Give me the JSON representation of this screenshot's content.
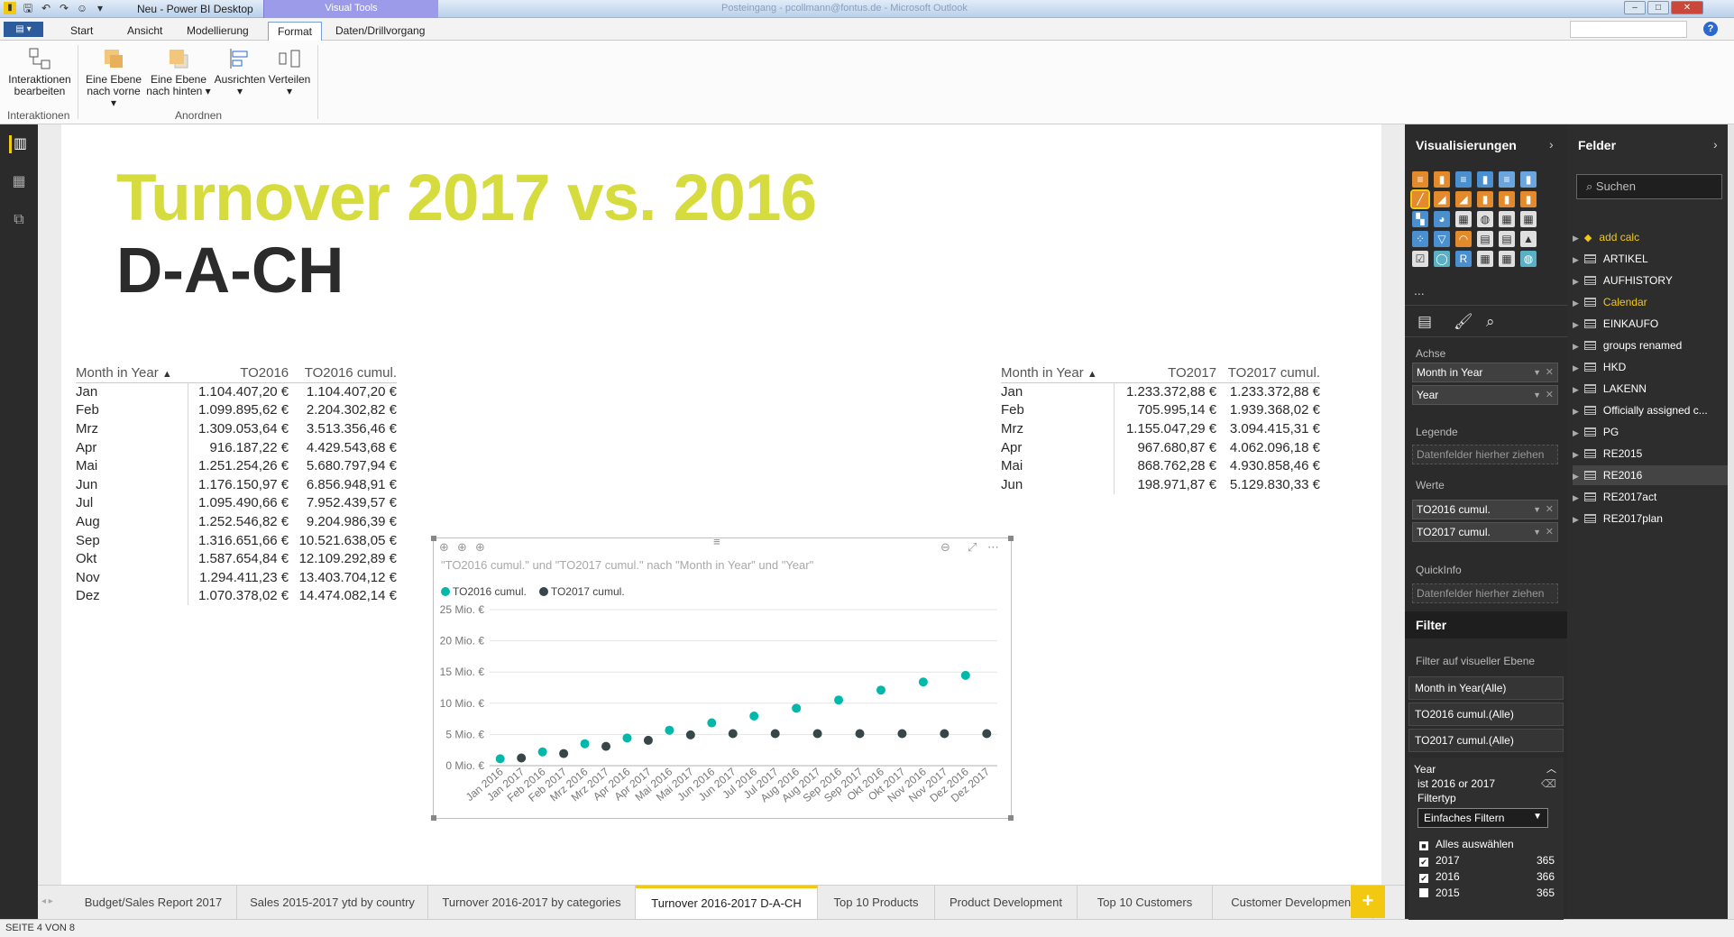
{
  "window": {
    "title": "Neu - Power BI Desktop",
    "visual_tools": "Visual Tools",
    "blurred_title": "Posteingang - pcollmann@fontus.de - Microsoft Outlook",
    "buttons": [
      "–",
      "□",
      "✕"
    ]
  },
  "ribbon_tabs": [
    "Start",
    "Ansicht",
    "Modellierung",
    "Format",
    "Daten/Drillvorgang"
  ],
  "ribbon": {
    "interactions": {
      "line1": "Interaktionen",
      "line2": "bearbeiten",
      "group": "Interaktionen"
    },
    "forward": {
      "line1": "Eine Ebene",
      "line2": "nach vorne ▾"
    },
    "backward": {
      "line1": "Eine Ebene",
      "line2": "nach hinten ▾"
    },
    "align": {
      "line1": "Ausrichten",
      "line2": "▾"
    },
    "distribute": {
      "line1": "Verteilen",
      "line2": "▾"
    },
    "arrange_group": "Anordnen"
  },
  "report": {
    "title_line1": "Turnover 2017 vs. 2016",
    "title_line2": "D-A-CH"
  },
  "table2016": {
    "headers": [
      "Month in Year",
      "TO2016",
      "TO2016 cumul."
    ],
    "rows": [
      [
        "Jan",
        "1.104.407,20 €",
        "1.104.407,20 €"
      ],
      [
        "Feb",
        "1.099.895,62 €",
        "2.204.302,82 €"
      ],
      [
        "Mrz",
        "1.309.053,64 €",
        "3.513.356,46 €"
      ],
      [
        "Apr",
        "916.187,22 €",
        "4.429.543,68 €"
      ],
      [
        "Mai",
        "1.251.254,26 €",
        "5.680.797,94 €"
      ],
      [
        "Jun",
        "1.176.150,97 €",
        "6.856.948,91 €"
      ],
      [
        "Jul",
        "1.095.490,66 €",
        "7.952.439,57 €"
      ],
      [
        "Aug",
        "1.252.546,82 €",
        "9.204.986,39 €"
      ],
      [
        "Sep",
        "1.316.651,66 €",
        "10.521.638,05 €"
      ],
      [
        "Okt",
        "1.587.654,84 €",
        "12.109.292,89 €"
      ],
      [
        "Nov",
        "1.294.411,23 €",
        "13.403.704,12 €"
      ],
      [
        "Dez",
        "1.070.378,02 €",
        "14.474.082,14 €"
      ]
    ]
  },
  "table2017": {
    "headers": [
      "Month in Year",
      "TO2017",
      "TO2017 cumul."
    ],
    "rows": [
      [
        "Jan",
        "1.233.372,88 €",
        "1.233.372,88 €"
      ],
      [
        "Feb",
        "705.995,14 €",
        "1.939.368,02 €"
      ],
      [
        "Mrz",
        "1.155.047,29 €",
        "3.094.415,31 €"
      ],
      [
        "Apr",
        "967.680,87 €",
        "4.062.096,18 €"
      ],
      [
        "Mai",
        "868.762,28 €",
        "4.930.858,46 €"
      ],
      [
        "Jun",
        "198.971,87 €",
        "5.129.830,33 €"
      ]
    ]
  },
  "chart_data": {
    "type": "scatter",
    "title": "\"TO2016 cumul.\" und \"TO2017 cumul.\" nach \"Month in Year\" und \"Year\"",
    "categories": [
      "Jan 2016",
      "Jan 2017",
      "Feb 2016",
      "Feb 2017",
      "Mrz 2016",
      "Mrz 2017",
      "Apr 2016",
      "Apr 2017",
      "Mai 2016",
      "Mai 2017",
      "Jun 2016",
      "Jun 2017",
      "Jul 2016",
      "Jul 2017",
      "Aug 2016",
      "Aug 2017",
      "Sep 2016",
      "Sep 2017",
      "Okt 2016",
      "Okt 2017",
      "Nov 2016",
      "Nov 2017",
      "Dez 2016",
      "Dez 2017"
    ],
    "series": [
      {
        "name": "TO2016 cumul.",
        "color": "#01b8aa",
        "values": [
          1.1,
          null,
          2.2,
          null,
          3.51,
          null,
          4.43,
          null,
          5.68,
          null,
          6.86,
          null,
          7.95,
          null,
          9.2,
          null,
          10.52,
          null,
          12.11,
          null,
          13.4,
          null,
          14.47,
          null
        ]
      },
      {
        "name": "TO2017 cumul.",
        "color": "#374649",
        "values": [
          null,
          1.23,
          null,
          1.94,
          null,
          3.09,
          null,
          4.06,
          null,
          4.93,
          null,
          5.13,
          null,
          5.13,
          null,
          5.13,
          null,
          5.13,
          null,
          5.13,
          null,
          5.13,
          null,
          5.13
        ]
      }
    ],
    "yticks": [
      "25 Mio. €",
      "20 Mio. €",
      "15 Mio. €",
      "10 Mio. €",
      "5 Mio. €",
      "0 Mio. €"
    ],
    "ylim": [
      0,
      25
    ],
    "legend_position": "top-left"
  },
  "page_tabs": [
    "Budget/Sales Report 2017",
    "Sales 2015-2017 ytd by country",
    "Turnover 2016-2017 by categories",
    "Turnover 2016-2017 D-A-CH",
    "Top 10 Products",
    "Product Development",
    "Top 10 Customers",
    "Customer Development"
  ],
  "add_tab": "+",
  "status": "SEITE 4 VON 8",
  "viz_pane": {
    "title": "Visualisierungen",
    "axis_label": "Achse",
    "axis_fields": [
      "Month in Year",
      "Year"
    ],
    "legend_label": "Legende",
    "legend_placeholder": "Datenfelder hierher ziehen",
    "values_label": "Werte",
    "values_fields": [
      "TO2016 cumul.",
      "TO2017 cumul."
    ],
    "tooltip_label": "QuickInfo",
    "tooltip_placeholder": "Datenfelder hierher ziehen",
    "more": "..."
  },
  "filters": {
    "title": "Filter",
    "level": "Filter auf visueller Ebene",
    "cards": [
      "Month in Year(Alle)",
      "TO2016 cumul.(Alle)",
      "TO2017 cumul.(Alle)"
    ],
    "year": {
      "name": "Year",
      "condition": "ist 2016 or 2017",
      "type_label": "Filtertyp",
      "type_value": "Einfaches Filtern",
      "select_all": "Alles auswählen",
      "items": [
        {
          "label": "2017",
          "count": "365",
          "checked": "✔"
        },
        {
          "label": "2016",
          "count": "366",
          "checked": "✔"
        },
        {
          "label": "2015",
          "count": "365",
          "checked": ""
        }
      ]
    }
  },
  "fields_pane": {
    "title": "Felder",
    "search_placeholder": "Suchen",
    "items": [
      "add calc",
      "ARTIKEL",
      "AUFHISTORY",
      "Calendar",
      "EINKAUFO",
      "groups renamed",
      "HKD",
      "LAKENN",
      "Officially assigned c...",
      "PG",
      "RE2015",
      "RE2016",
      "RE2017act",
      "RE2017plan"
    ]
  }
}
